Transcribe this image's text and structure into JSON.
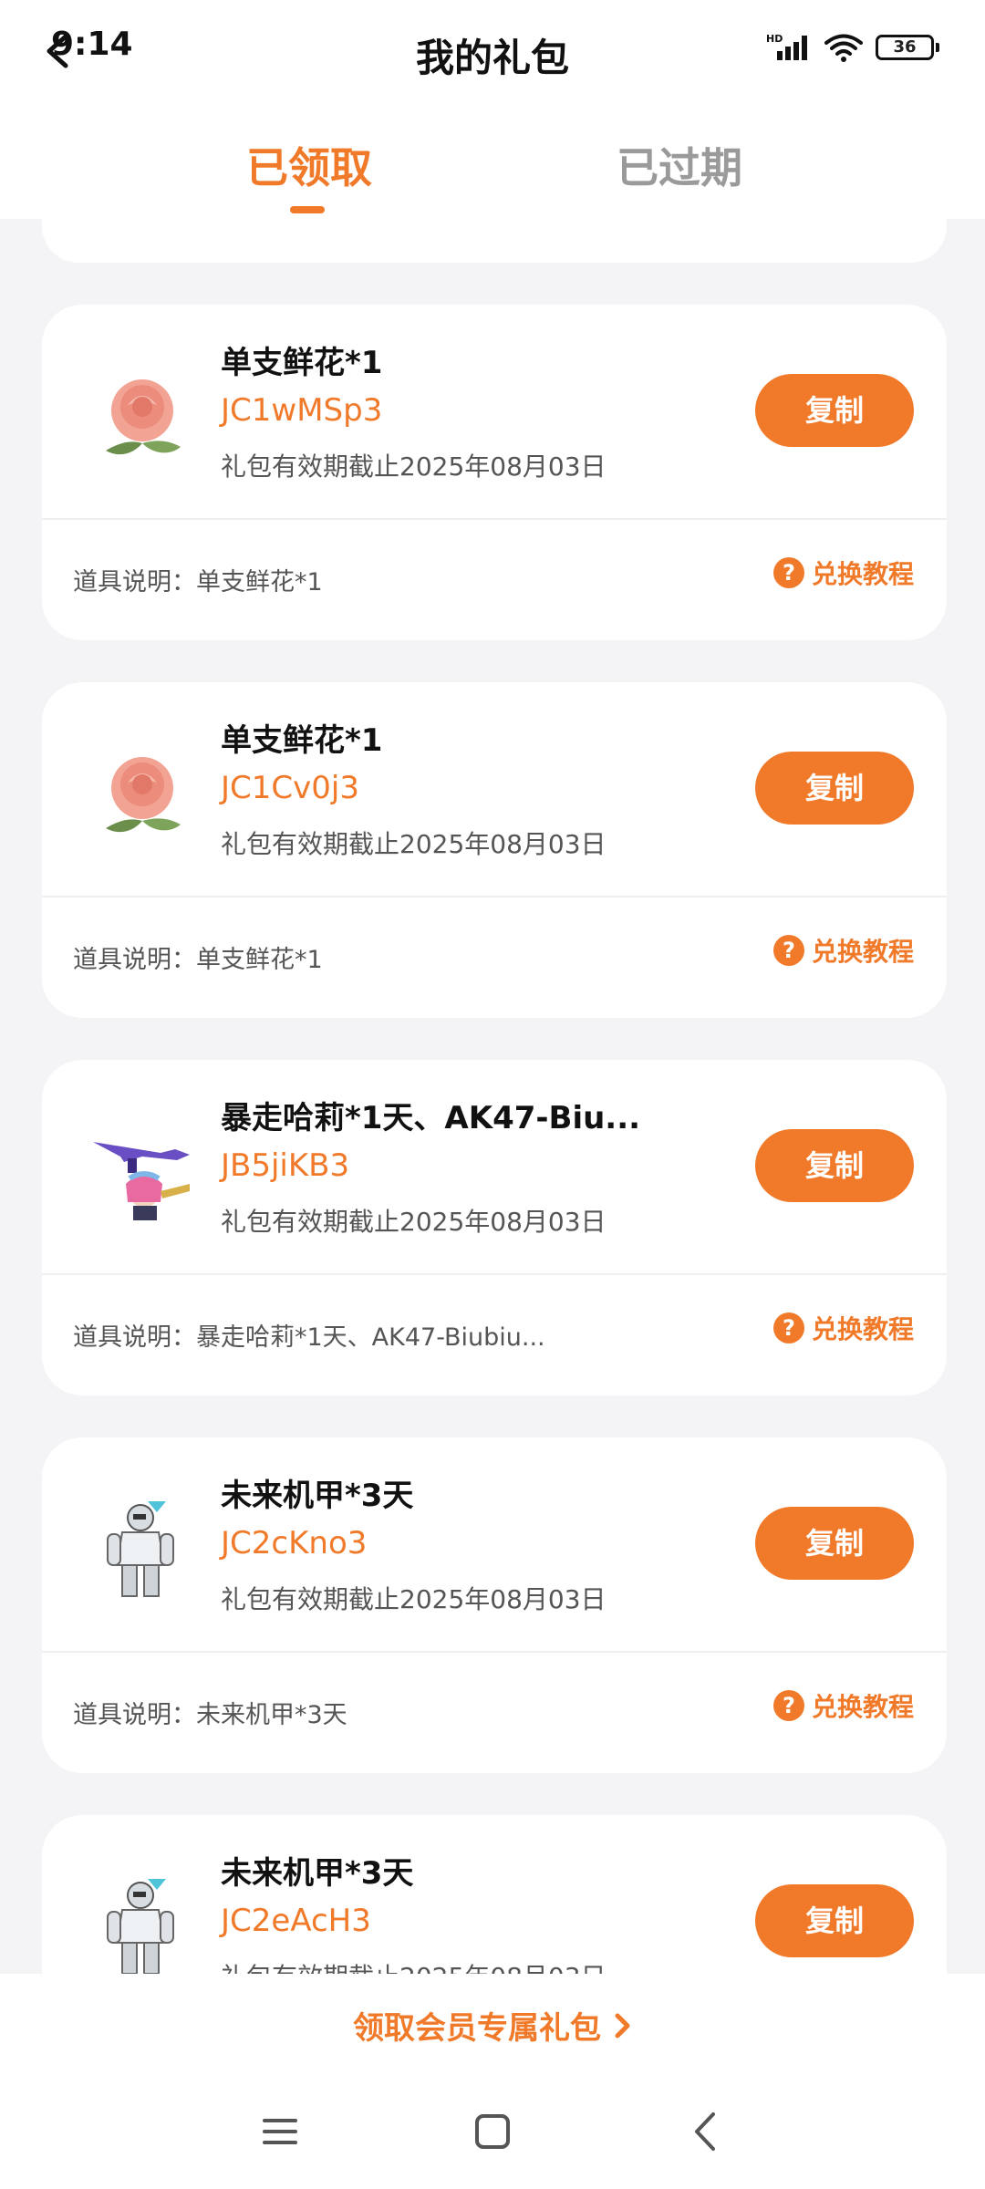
{
  "status_bar": {
    "time": "9:14",
    "network": "HD",
    "battery": "36"
  },
  "header": {
    "title": "我的礼包"
  },
  "tabs": [
    {
      "label": "已领取",
      "active": true
    },
    {
      "label": "已过期",
      "active": false
    }
  ],
  "colors": {
    "accent": "#f07a2a",
    "background": "#f4f4f6"
  },
  "gifts": [
    {
      "name": "单支鲜花*1",
      "code": "JC1wMSp3",
      "expiry": "礼包有效期截止2025年08月03日",
      "copy_label": "复制",
      "desc": "道具说明：单支鲜花*1",
      "tutorial_label": "兑换教程",
      "thumb": "rose-icon"
    },
    {
      "name": "单支鲜花*1",
      "code": "JC1Cv0j3",
      "expiry": "礼包有效期截止2025年08月03日",
      "copy_label": "复制",
      "desc": "道具说明：单支鲜花*1",
      "tutorial_label": "兑换教程",
      "thumb": "rose-icon"
    },
    {
      "name": "暴走哈莉*1天、AK47-Biu...",
      "code": "JB5jiKB3",
      "expiry": "礼包有效期截止2025年08月03日",
      "copy_label": "复制",
      "desc": "道具说明：暴走哈莉*1天、AK47-Biubiu...",
      "tutorial_label": "兑换教程",
      "thumb": "character-rifle-icon"
    },
    {
      "name": "未来机甲*3天",
      "code": "JC2cKno3",
      "expiry": "礼包有效期截止2025年08月03日",
      "copy_label": "复制",
      "desc": "道具说明：未来机甲*3天",
      "tutorial_label": "兑换教程",
      "thumb": "robot-icon"
    },
    {
      "name": "未来机甲*3天",
      "code": "JC2eAcH3",
      "expiry": "礼包有效期截止2025年08月03日",
      "copy_label": "复制",
      "thumb": "robot-icon"
    }
  ],
  "member_banner": {
    "label": "领取会员专属礼包"
  },
  "nav": {
    "buttons": [
      "menu-icon",
      "home-icon",
      "back-icon"
    ]
  }
}
